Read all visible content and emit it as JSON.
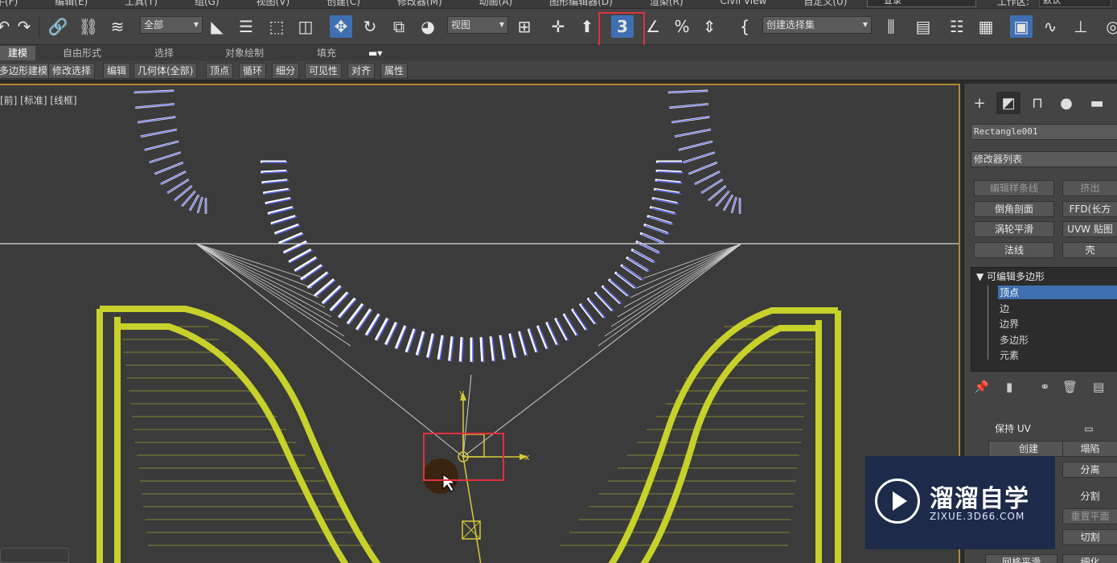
{
  "menu": {
    "items": [
      "牛(F)",
      "编辑(E)",
      "工具(T)",
      "组(G)",
      "视图(V)",
      "创建(C)",
      "修改器(M)",
      "动画(A)",
      "图形编辑器(D)",
      "渲染(R)",
      "Civil View",
      "自定义(U)"
    ],
    "login": "登录",
    "workspace_label": "工作区:",
    "workspace_value": "默认"
  },
  "toolbar": {
    "filter_select": "全部",
    "view_select": "视图",
    "selection_set": "创建选择集"
  },
  "ribbon": {
    "tabs": [
      "建模",
      "自由形式",
      "选择",
      "对象绘制",
      "填充"
    ],
    "sub": [
      "多边形建模",
      "修改选择",
      "编辑",
      "几何体(全部)",
      "顶点",
      "循环",
      "细分",
      "可见性",
      "对齐",
      "属性"
    ]
  },
  "viewport": {
    "label": "[前] [标准] [线框]",
    "axis_x": "x",
    "axis_y": "y"
  },
  "panel": {
    "object_name": "Rectangle001",
    "modifier_list": "修改器列表",
    "buttons": [
      "编辑样条线",
      "挤出",
      "倒角剖面",
      "FFD(长方",
      "涡轮平滑",
      "UVW 贴图",
      "法线",
      "壳"
    ],
    "stack_root": "可编辑多边形",
    "stack_items": [
      "顶点",
      "边",
      "边界",
      "多边形",
      "元素"
    ],
    "preserve_uv": "保持 UV",
    "create": "创建",
    "collapse": "塌陷",
    "detach": "分离",
    "split": "分割",
    "reset_plane": "重置平面",
    "cut": "切割",
    "meshsmooth": "网格平滑",
    "tessellate": "细化"
  },
  "watermark": {
    "title": "溜溜自学",
    "subtitle": "ZIXUE.3D66.COM"
  },
  "colors": {
    "accent": "#3f6fb0",
    "highlight_red": "#e0323b",
    "wire_white": "#ffffff",
    "wire_blue": "#5a64e6",
    "wire_yellow": "#c7d12a",
    "viewport_border": "#b08a33"
  }
}
